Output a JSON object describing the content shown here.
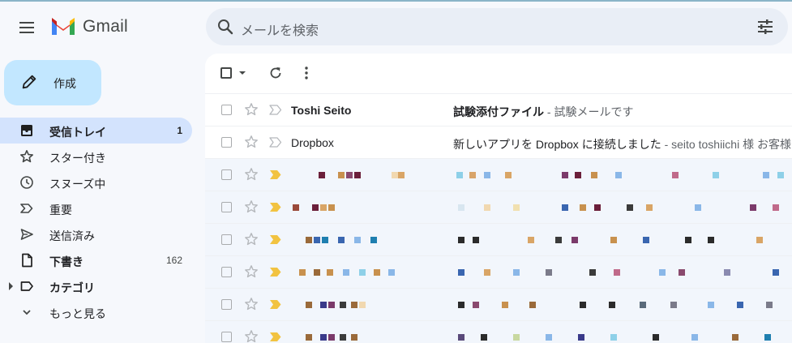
{
  "app": {
    "name": "Gmail"
  },
  "search": {
    "placeholder": "メールを検索"
  },
  "compose": {
    "label": "作成"
  },
  "sidebar": {
    "items": [
      {
        "label": "受信トレイ",
        "count": "1",
        "icon": "inbox-icon"
      },
      {
        "label": "スター付き",
        "count": "",
        "icon": "star-icon"
      },
      {
        "label": "スヌーズ中",
        "count": "",
        "icon": "clock-icon"
      },
      {
        "label": "重要",
        "count": "",
        "icon": "important-icon"
      },
      {
        "label": "送信済み",
        "count": "",
        "icon": "send-icon"
      },
      {
        "label": "下書き",
        "count": "162",
        "icon": "draft-icon"
      },
      {
        "label": "カテゴリ",
        "count": "",
        "icon": "label-icon"
      },
      {
        "label": "もっと見る",
        "count": "",
        "icon": "chevron-down-icon"
      }
    ]
  },
  "emails": [
    {
      "sender": "Toshi Seito",
      "subject": "試験添付ファイル",
      "snippet": " - 試験メールです",
      "unread": true
    },
    {
      "sender": "Dropbox",
      "subject": "新しいアプリを Dropbox に接続しました",
      "snippet": " - seito toshiichi 様 お客様",
      "unread": false
    }
  ],
  "colors": {
    "accent": "#c2e7ff",
    "active_nav": "#d3e3fd",
    "important_marker": "#f2c341",
    "background": "#f6f8fc"
  }
}
